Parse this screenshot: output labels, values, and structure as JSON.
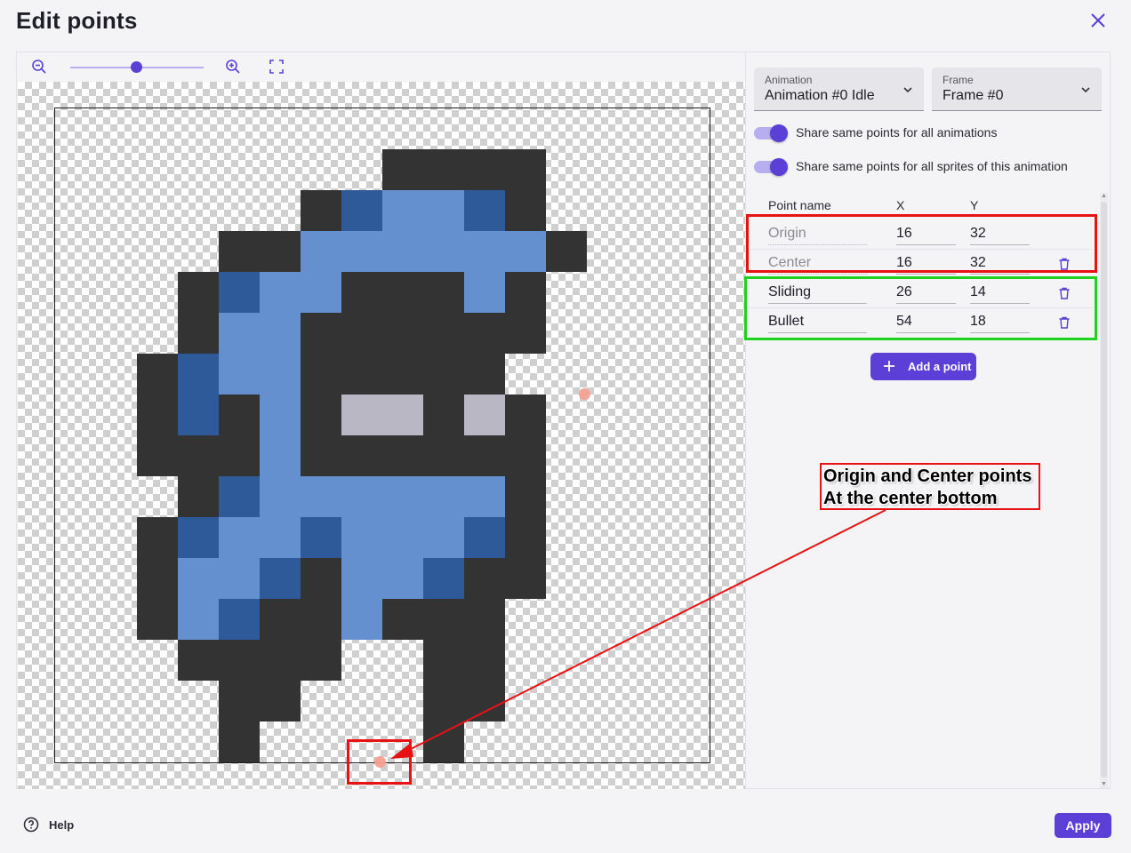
{
  "dialog": {
    "title": "Edit points",
    "close_icon": "close-icon"
  },
  "toolbar": {
    "zoom_out_icon": "zoom-out-icon",
    "zoom_in_icon": "zoom-in-icon",
    "fit_icon": "fit-to-view-icon"
  },
  "colors": {
    "accent": "#5b3fd6",
    "accent_light": "#b7aef0",
    "sprite_dark": "#333333",
    "sprite_blue": "#6590cf",
    "sprite_blue_dark": "#2f5a9a",
    "sprite_grey": "#b9b7c4",
    "point_marker": "#f3a08f",
    "annotation_red": "#e81212",
    "annotation_green": "#1ed31e"
  },
  "sprite": {
    "cols": 16,
    "rows": 16,
    "legend": {
      "K": "sprite_dark",
      "L": "sprite_blue",
      "D": "sprite_blue_dark",
      "G": "sprite_grey",
      ".": "transparent"
    },
    "pixels": [
      "................",
      "........KKKK....",
      "......KDLLDK....",
      "....KKLLLLLLK...",
      "...KDLLKKKLK....",
      "...KLLKKKKKK....",
      "..KDLLKKKKK.....",
      "..KDKLKGGKGK....",
      "..KKKLKKKKKK....",
      "...KDLLLLLLK....",
      "..KDLLDLLLDK....",
      "..KLLDKLLDKK....",
      "..KLDKKLKKK.....",
      "...KKKK..KK.....",
      "....KK...KK.....",
      "....K....K......"
    ]
  },
  "canvas_points": [
    {
      "name": "Origin",
      "x": 16,
      "y": 32
    },
    {
      "name": "Sliding",
      "x": 26,
      "y": 14
    }
  ],
  "panel": {
    "animation_select": {
      "label": "Animation",
      "value": "Animation #0 Idle"
    },
    "frame_select": {
      "label": "Frame",
      "value": "Frame #0"
    },
    "toggles": [
      {
        "label": "Share same points for all animations",
        "checked": true
      },
      {
        "label": "Share same points for all sprites of this animation",
        "checked": true
      }
    ],
    "table": {
      "headers": {
        "name": "Point name",
        "x": "X",
        "y": "Y"
      },
      "rows": [
        {
          "name": "Origin",
          "x": "16",
          "y": "32",
          "default": true,
          "deletable": false
        },
        {
          "name": "Center",
          "x": "16",
          "y": "32",
          "default": true,
          "deletable": true
        },
        {
          "name": "Sliding",
          "x": "26",
          "y": "14",
          "default": false,
          "deletable": true
        },
        {
          "name": "Bullet",
          "x": "54",
          "y": "18",
          "default": false,
          "deletable": true
        }
      ]
    },
    "add_button": {
      "label": "Add a point",
      "icon": "plus-icon"
    }
  },
  "annotation": {
    "line1": "Origin and Center points",
    "line2": "At the center bottom"
  },
  "footer": {
    "help_label": "Help",
    "help_icon": "help-circle-icon",
    "apply_label": "Apply"
  }
}
